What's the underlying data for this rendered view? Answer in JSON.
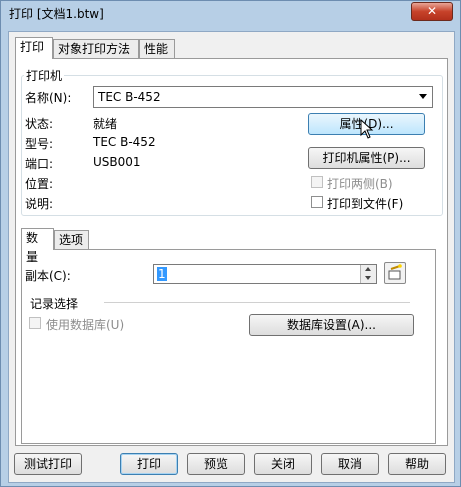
{
  "window": {
    "title": "打印 [文档1.btw]",
    "close_label": "✕"
  },
  "tabs": [
    {
      "label": "打印"
    },
    {
      "label": "对象打印方法"
    },
    {
      "label": "性能"
    }
  ],
  "printer_group": {
    "title": "打印机",
    "name_label": "名称(N):",
    "name_value": "TEC B-452",
    "status_label": "状态:",
    "status_value": "就绪",
    "type_label": "型号:",
    "type_value": "TEC B-452",
    "port_label": "端口:",
    "port_value": "USB001",
    "location_label": "位置:",
    "location_value": "",
    "comment_label": "说明:",
    "comment_value": "",
    "properties_button": "属性(D)...",
    "printer_properties_button": "打印机属性(P)...",
    "duplex_label": "打印两侧(B)",
    "duplex_checked": false,
    "print_to_file_label": "打印到文件(F)",
    "print_to_file_checked": false
  },
  "subtabs": [
    {
      "label": "数量"
    },
    {
      "label": "选项"
    }
  ],
  "quantity": {
    "copies_label": "副本(C):",
    "copies_value": "1",
    "record_section_label": "记录选择",
    "use_database_label": "使用数据库(U)",
    "use_database_checked": false,
    "database_setup_button": "数据库设置(A)..."
  },
  "footer": {
    "test_print": "测试打印",
    "print": "打印",
    "preview": "预览",
    "close": "关闭",
    "cancel": "取消",
    "help": "帮助"
  },
  "colors": {
    "frame": "#b7cfe6",
    "close_button": "#c7422a",
    "hot_button": "#bee6fd"
  }
}
